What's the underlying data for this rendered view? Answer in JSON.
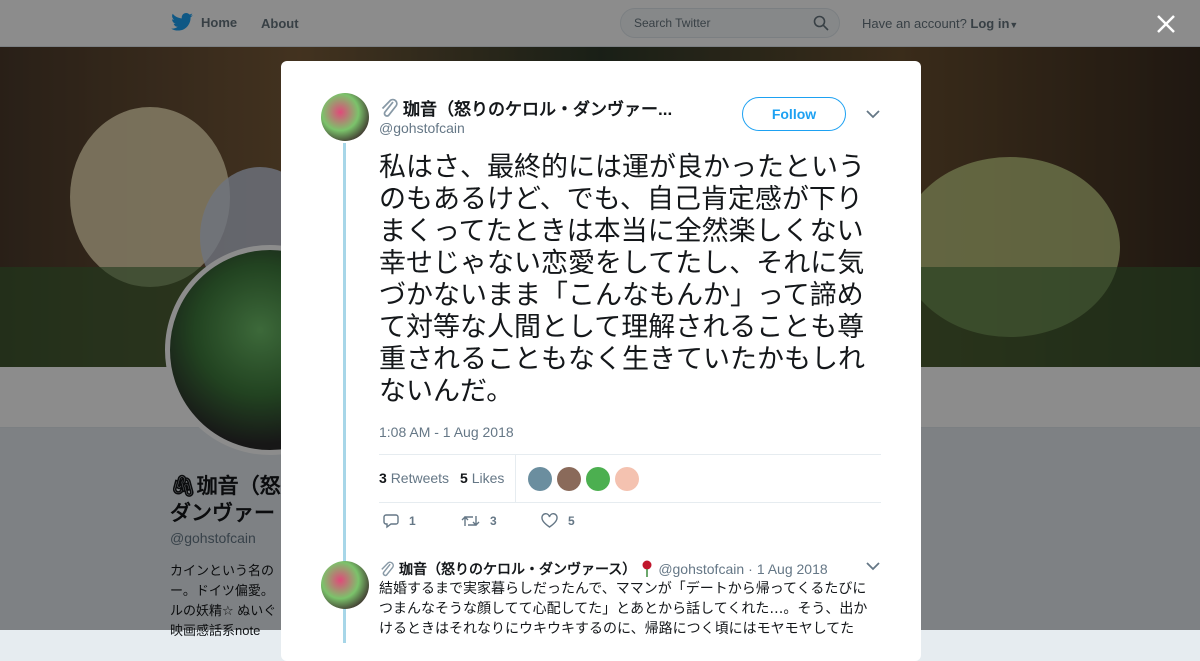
{
  "topbar": {
    "home_label": "Home",
    "about_label": "About",
    "search_placeholder": "Search Twitter",
    "account_prompt": "Have an account?",
    "login_label": "Log in"
  },
  "background_profile": {
    "name": "🖇珈音（怒りのケロル・ダンヴァース）",
    "name_line1": "🖇珈音（怒",
    "name_line2": "ダンヴァー",
    "handle": "@gohstofcain",
    "bio": "カインという名の ー。ドイツ偏愛。 ルの妖精☆ ぬいぐ 映画感話系note"
  },
  "modal": {
    "author": {
      "name": "珈音（怒りのケロル・ダンヴァー...",
      "handle": "@gohstofcain",
      "name_icon": "paperclip-icon"
    },
    "follow_label": "Follow",
    "tweet_text": "私はさ、最終的には運が良かったというのもあるけど、でも、自己肯定感が下りまくってたときは本当に全然楽しくない幸せじゃない恋愛をしてたし、それに気づかないまま「こんなもんか」って諦めて対等な人間として理解されることも尊重されることもなく生きていたかもしれないんだ。",
    "timestamp": "1:08 AM - 1 Aug 2018",
    "stats": {
      "retweets_count": "3",
      "retweets_label": "Retweets",
      "likes_count": "5",
      "likes_label": "Likes"
    },
    "liker_avatar_colors": [
      "#6b8e9f",
      "#8a6a5a",
      "#4caf50",
      "#f4c2b0"
    ],
    "actions": {
      "reply_count": "1",
      "retweet_count": "3",
      "like_count": "5"
    },
    "reply": {
      "name": "珈音（怒りのケロル・ダンヴァース）",
      "handle": "@gohstofcain",
      "separator": "·",
      "date": "1 Aug 2018",
      "text": "結婚するまで実家暮らしだったんで、ママンが「デートから帰ってくるたびにつまんなそうな顔してて心配してた」とあとから話してくれた…。そう、出かけるときはそれなりにウキウキするのに、帰路につく頃にはモヤモヤしてた"
    }
  },
  "colors": {
    "accent": "#1da1f2",
    "thread_line": "#a7d6e8"
  }
}
